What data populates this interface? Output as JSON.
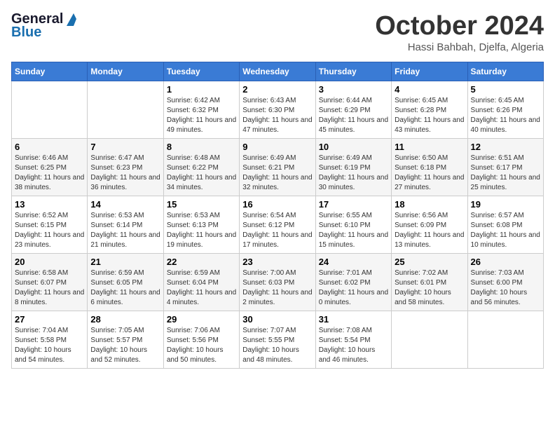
{
  "logo": {
    "line1": "General",
    "line2": "Blue"
  },
  "title": "October 2024",
  "location": "Hassi Bahbah, Djelfa, Algeria",
  "days_of_week": [
    "Sunday",
    "Monday",
    "Tuesday",
    "Wednesday",
    "Thursday",
    "Friday",
    "Saturday"
  ],
  "weeks": [
    [
      {
        "day": "",
        "sunrise": "",
        "sunset": "",
        "daylight": ""
      },
      {
        "day": "",
        "sunrise": "",
        "sunset": "",
        "daylight": ""
      },
      {
        "day": "1",
        "sunrise": "Sunrise: 6:42 AM",
        "sunset": "Sunset: 6:32 PM",
        "daylight": "Daylight: 11 hours and 49 minutes."
      },
      {
        "day": "2",
        "sunrise": "Sunrise: 6:43 AM",
        "sunset": "Sunset: 6:30 PM",
        "daylight": "Daylight: 11 hours and 47 minutes."
      },
      {
        "day": "3",
        "sunrise": "Sunrise: 6:44 AM",
        "sunset": "Sunset: 6:29 PM",
        "daylight": "Daylight: 11 hours and 45 minutes."
      },
      {
        "day": "4",
        "sunrise": "Sunrise: 6:45 AM",
        "sunset": "Sunset: 6:28 PM",
        "daylight": "Daylight: 11 hours and 43 minutes."
      },
      {
        "day": "5",
        "sunrise": "Sunrise: 6:45 AM",
        "sunset": "Sunset: 6:26 PM",
        "daylight": "Daylight: 11 hours and 40 minutes."
      }
    ],
    [
      {
        "day": "6",
        "sunrise": "Sunrise: 6:46 AM",
        "sunset": "Sunset: 6:25 PM",
        "daylight": "Daylight: 11 hours and 38 minutes."
      },
      {
        "day": "7",
        "sunrise": "Sunrise: 6:47 AM",
        "sunset": "Sunset: 6:23 PM",
        "daylight": "Daylight: 11 hours and 36 minutes."
      },
      {
        "day": "8",
        "sunrise": "Sunrise: 6:48 AM",
        "sunset": "Sunset: 6:22 PM",
        "daylight": "Daylight: 11 hours and 34 minutes."
      },
      {
        "day": "9",
        "sunrise": "Sunrise: 6:49 AM",
        "sunset": "Sunset: 6:21 PM",
        "daylight": "Daylight: 11 hours and 32 minutes."
      },
      {
        "day": "10",
        "sunrise": "Sunrise: 6:49 AM",
        "sunset": "Sunset: 6:19 PM",
        "daylight": "Daylight: 11 hours and 30 minutes."
      },
      {
        "day": "11",
        "sunrise": "Sunrise: 6:50 AM",
        "sunset": "Sunset: 6:18 PM",
        "daylight": "Daylight: 11 hours and 27 minutes."
      },
      {
        "day": "12",
        "sunrise": "Sunrise: 6:51 AM",
        "sunset": "Sunset: 6:17 PM",
        "daylight": "Daylight: 11 hours and 25 minutes."
      }
    ],
    [
      {
        "day": "13",
        "sunrise": "Sunrise: 6:52 AM",
        "sunset": "Sunset: 6:15 PM",
        "daylight": "Daylight: 11 hours and 23 minutes."
      },
      {
        "day": "14",
        "sunrise": "Sunrise: 6:53 AM",
        "sunset": "Sunset: 6:14 PM",
        "daylight": "Daylight: 11 hours and 21 minutes."
      },
      {
        "day": "15",
        "sunrise": "Sunrise: 6:53 AM",
        "sunset": "Sunset: 6:13 PM",
        "daylight": "Daylight: 11 hours and 19 minutes."
      },
      {
        "day": "16",
        "sunrise": "Sunrise: 6:54 AM",
        "sunset": "Sunset: 6:12 PM",
        "daylight": "Daylight: 11 hours and 17 minutes."
      },
      {
        "day": "17",
        "sunrise": "Sunrise: 6:55 AM",
        "sunset": "Sunset: 6:10 PM",
        "daylight": "Daylight: 11 hours and 15 minutes."
      },
      {
        "day": "18",
        "sunrise": "Sunrise: 6:56 AM",
        "sunset": "Sunset: 6:09 PM",
        "daylight": "Daylight: 11 hours and 13 minutes."
      },
      {
        "day": "19",
        "sunrise": "Sunrise: 6:57 AM",
        "sunset": "Sunset: 6:08 PM",
        "daylight": "Daylight: 11 hours and 10 minutes."
      }
    ],
    [
      {
        "day": "20",
        "sunrise": "Sunrise: 6:58 AM",
        "sunset": "Sunset: 6:07 PM",
        "daylight": "Daylight: 11 hours and 8 minutes."
      },
      {
        "day": "21",
        "sunrise": "Sunrise: 6:59 AM",
        "sunset": "Sunset: 6:05 PM",
        "daylight": "Daylight: 11 hours and 6 minutes."
      },
      {
        "day": "22",
        "sunrise": "Sunrise: 6:59 AM",
        "sunset": "Sunset: 6:04 PM",
        "daylight": "Daylight: 11 hours and 4 minutes."
      },
      {
        "day": "23",
        "sunrise": "Sunrise: 7:00 AM",
        "sunset": "Sunset: 6:03 PM",
        "daylight": "Daylight: 11 hours and 2 minutes."
      },
      {
        "day": "24",
        "sunrise": "Sunrise: 7:01 AM",
        "sunset": "Sunset: 6:02 PM",
        "daylight": "Daylight: 11 hours and 0 minutes."
      },
      {
        "day": "25",
        "sunrise": "Sunrise: 7:02 AM",
        "sunset": "Sunset: 6:01 PM",
        "daylight": "Daylight: 10 hours and 58 minutes."
      },
      {
        "day": "26",
        "sunrise": "Sunrise: 7:03 AM",
        "sunset": "Sunset: 6:00 PM",
        "daylight": "Daylight: 10 hours and 56 minutes."
      }
    ],
    [
      {
        "day": "27",
        "sunrise": "Sunrise: 7:04 AM",
        "sunset": "Sunset: 5:58 PM",
        "daylight": "Daylight: 10 hours and 54 minutes."
      },
      {
        "day": "28",
        "sunrise": "Sunrise: 7:05 AM",
        "sunset": "Sunset: 5:57 PM",
        "daylight": "Daylight: 10 hours and 52 minutes."
      },
      {
        "day": "29",
        "sunrise": "Sunrise: 7:06 AM",
        "sunset": "Sunset: 5:56 PM",
        "daylight": "Daylight: 10 hours and 50 minutes."
      },
      {
        "day": "30",
        "sunrise": "Sunrise: 7:07 AM",
        "sunset": "Sunset: 5:55 PM",
        "daylight": "Daylight: 10 hours and 48 minutes."
      },
      {
        "day": "31",
        "sunrise": "Sunrise: 7:08 AM",
        "sunset": "Sunset: 5:54 PM",
        "daylight": "Daylight: 10 hours and 46 minutes."
      },
      {
        "day": "",
        "sunrise": "",
        "sunset": "",
        "daylight": ""
      },
      {
        "day": "",
        "sunrise": "",
        "sunset": "",
        "daylight": ""
      }
    ]
  ]
}
